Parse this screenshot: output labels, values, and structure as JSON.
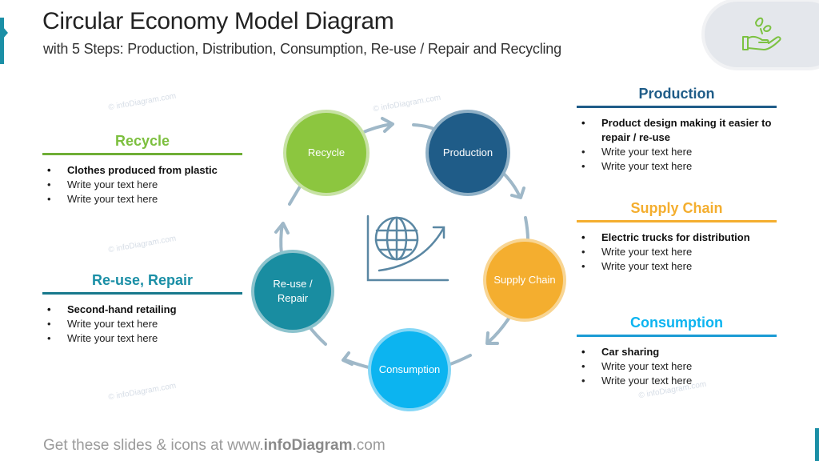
{
  "header": {
    "title": "Circular Economy Model Diagram",
    "subtitle": "with 5 Steps: Production, Distribution, Consumption, Re-use  / Repair and Recycling",
    "logo_icon": "hand-with-leaves-icon"
  },
  "colors": {
    "recycle": "#8cc63f",
    "production": "#1f5c88",
    "supply_chain": "#f4ae2f",
    "consumption": "#0cb4f0",
    "reuse": "#198da1",
    "arrow": "#9fb8c8",
    "accent": "#1b8fa6"
  },
  "cycle": {
    "center_icon": "global-growth-icon",
    "nodes": [
      {
        "id": "recycle",
        "label": "Recycle"
      },
      {
        "id": "production",
        "label": "Production"
      },
      {
        "id": "supply_chain",
        "label": "Supply Chain"
      },
      {
        "id": "consumption",
        "label": "Consumption"
      },
      {
        "id": "reuse",
        "label_line1": "Re-use /",
        "label_line2": "Repair"
      }
    ]
  },
  "panels": {
    "recycle": {
      "title": "Recycle",
      "items": [
        "Clothes produced from plastic",
        "Write your text here",
        "Write your text here"
      ]
    },
    "reuse": {
      "title": "Re-use, Repair",
      "items": [
        "Second-hand retailing",
        "Write your text here",
        "Write your text here"
      ]
    },
    "production": {
      "title": "Production",
      "items": [
        "Product design making it easier to repair / re-use",
        "Write your text here",
        "Write your text here"
      ]
    },
    "supply_chain": {
      "title": "Supply Chain",
      "items": [
        "Electric trucks for distribution",
        "Write your text here",
        "Write your text here"
      ]
    },
    "consumption": {
      "title": "Consumption",
      "items": [
        "Car sharing",
        "Write your text here",
        "Write your text here"
      ]
    }
  },
  "watermark": "© infoDiagram.com",
  "footer": {
    "prefix": "Get these slides & icons at www.",
    "brand": "infoDiagram",
    "suffix": ".com"
  }
}
